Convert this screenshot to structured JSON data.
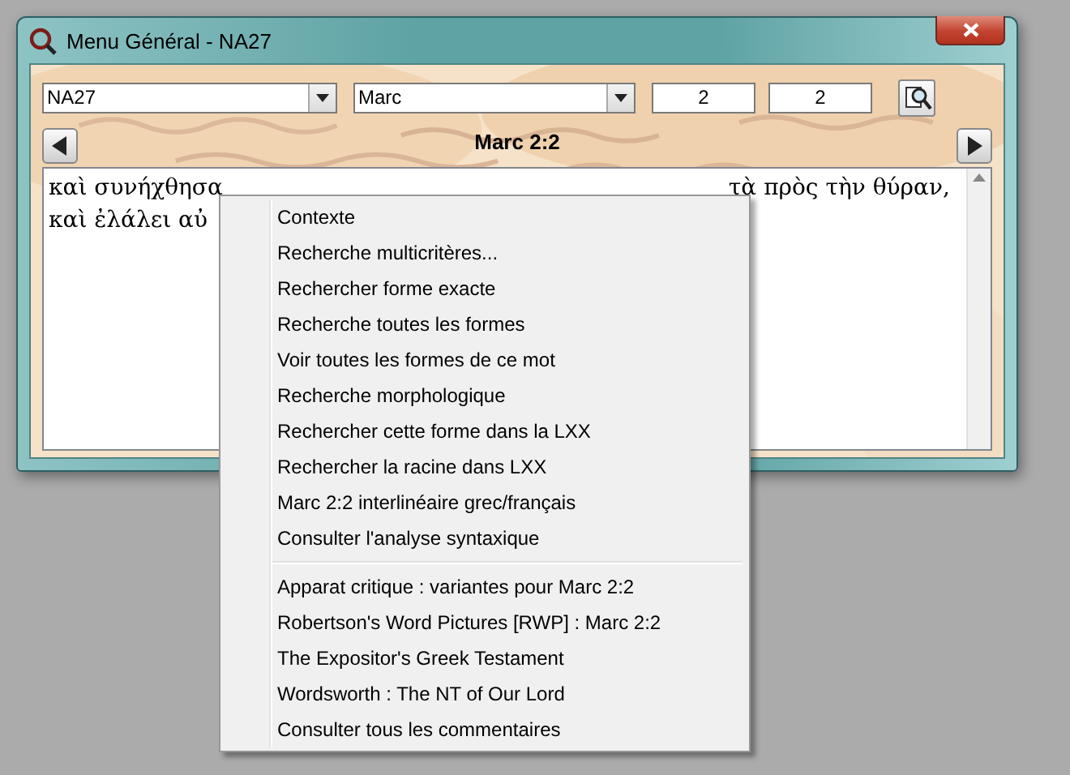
{
  "window": {
    "title": "Menu Général - NA27"
  },
  "toolbar": {
    "version": {
      "value": "NA27"
    },
    "book": {
      "value": "Marc"
    },
    "chapter": {
      "value": "2"
    },
    "verse": {
      "value": "2"
    }
  },
  "reference": "Marc 2:2",
  "text_lines": [
    {
      "segments": [
        "καὶ συνήχθησα",
        "τὰ πρὸς τὴν θύραν,"
      ]
    },
    {
      "segments": [
        "καὶ ἐλάλει αὐ"
      ]
    }
  ],
  "context_menu": {
    "groups": [
      [
        "Contexte",
        "Recherche multicritères...",
        "Rechercher forme exacte",
        "Recherche toutes les formes",
        "Voir toutes les formes de ce mot",
        "Recherche morphologique",
        "Rechercher cette forme dans la LXX",
        "Rechercher la racine dans LXX",
        "Marc 2:2 interlinéaire grec/français",
        "Consulter l'analyse syntaxique"
      ],
      [
        "Apparat critique : variantes pour Marc 2:2",
        "Robertson's Word Pictures [RWP] : Marc 2:2",
        "The Expositor's Greek Testament",
        "Wordsworth : The NT of Our Lord",
        "Consulter tous les commentaires"
      ]
    ]
  }
}
